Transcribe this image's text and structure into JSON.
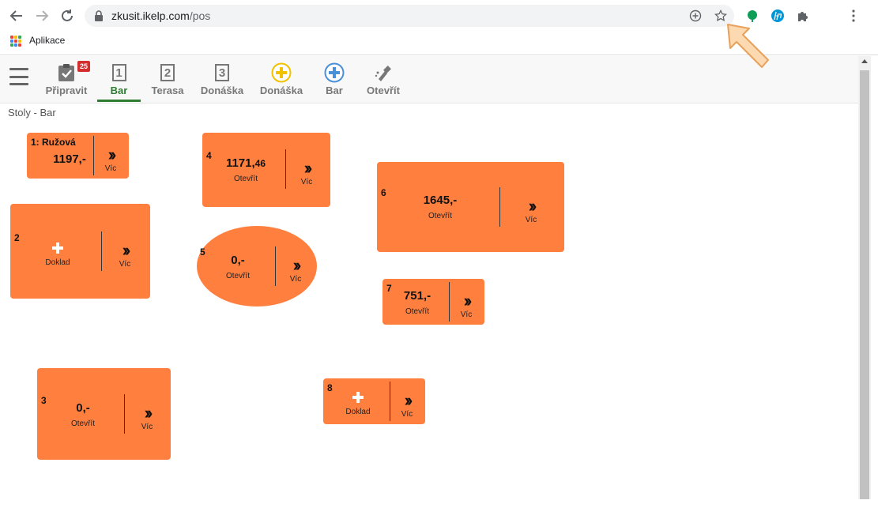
{
  "browser": {
    "url_host": "zkusit.ikelp.com",
    "url_path": "/pos",
    "bookmarks": {
      "apps_label": "Aplikace"
    }
  },
  "toolbar": {
    "items": [
      {
        "label": "Připravit",
        "badge": "25"
      },
      {
        "label": "Bar",
        "num": "1"
      },
      {
        "label": "Terasa",
        "num": "2"
      },
      {
        "label": "Donáška",
        "num": "3"
      },
      {
        "label": "Donáška"
      },
      {
        "label": "Bar"
      },
      {
        "label": "Otevřít"
      }
    ]
  },
  "floor": {
    "title": "Stoly - Bar",
    "more_label": "Víc",
    "tables": [
      {
        "num": "1: Ružová",
        "amount": "1197,-"
      },
      {
        "num": "4",
        "amount_main": "1171,",
        "amount_small": "46",
        "sub": "Otevřít"
      },
      {
        "num": "6",
        "amount": "1645,-",
        "sub": "Otevřít"
      },
      {
        "num": "2",
        "sub": "Doklad"
      },
      {
        "num": "5",
        "amount": "0,-",
        "sub": "Otevřít"
      },
      {
        "num": "7",
        "amount": "751,-",
        "sub": "Otevřít"
      },
      {
        "num": "3",
        "amount": "0,-",
        "sub": "Otevřít"
      },
      {
        "num": "8",
        "sub": "Doklad"
      }
    ]
  },
  "colors": {
    "table": "#ff7f3f",
    "active": "#2e7d32",
    "badge": "#d32f2f"
  }
}
